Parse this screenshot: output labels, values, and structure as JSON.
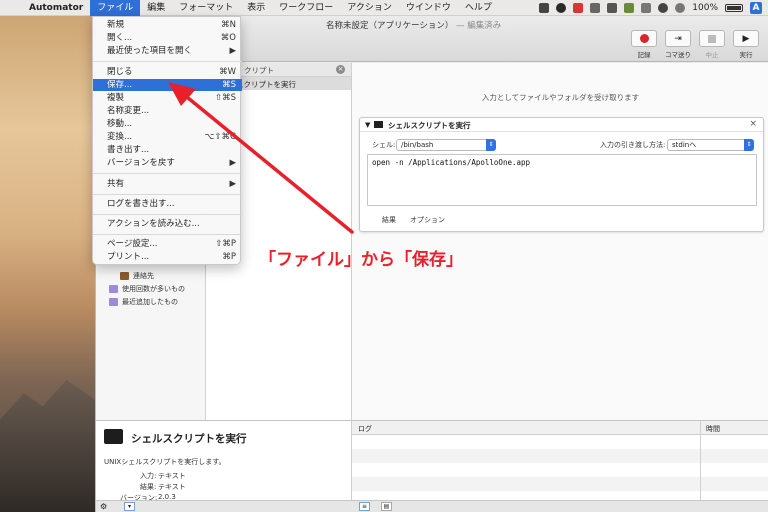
{
  "menubar": {
    "app_name": "Automator",
    "items": [
      "ファイル",
      "編集",
      "フォーマット",
      "表示",
      "ワークフロー",
      "アクション",
      "ウインドウ",
      "ヘルプ"
    ],
    "battery": "100%"
  },
  "window": {
    "title": "名称未設定（アプリケーション）",
    "title_sub": "— 編集済み",
    "toolbar": [
      {
        "label": "記録",
        "icon": "record-icon"
      },
      {
        "label": "コマ送り",
        "icon": "step-icon"
      },
      {
        "label": "中止",
        "icon": "stop-icon"
      },
      {
        "label": "実行",
        "icon": "run-icon"
      }
    ]
  },
  "file_menu": {
    "items": [
      {
        "label": "新規",
        "shortcut": "⌘N"
      },
      {
        "label": "開く...",
        "shortcut": "⌘O"
      },
      {
        "label": "最近使った項目を開く",
        "shortcut": "▶"
      },
      {
        "label": "閉じる",
        "shortcut": "⌘W"
      },
      {
        "label": "保存...",
        "shortcut": "⌘S"
      },
      {
        "label": "複製",
        "shortcut": "⇧⌘S"
      },
      {
        "label": "名称変更...",
        "shortcut": ""
      },
      {
        "label": "移動...",
        "shortcut": ""
      },
      {
        "label": "変換...",
        "shortcut": "⌥⇧⌘C"
      },
      {
        "label": "書き出す...",
        "shortcut": ""
      },
      {
        "label": "バージョンを戻す",
        "shortcut": "▶"
      },
      {
        "label": "共有",
        "shortcut": "▶"
      },
      {
        "label": "ログを書き出す...",
        "shortcut": ""
      },
      {
        "label": "アクションを読み込む...",
        "shortcut": ""
      },
      {
        "label": "ページ設定...",
        "shortcut": "⇧⌘P"
      },
      {
        "label": "プリント...",
        "shortcut": "⌘P"
      }
    ]
  },
  "library": {
    "header_title": "クリプト",
    "selected_item": "スクリプトを実行",
    "items": [
      "連絡先",
      "使用回数が多いもの",
      "最近追加したもの"
    ]
  },
  "workflow": {
    "drop_message": "入力としてファイルやフォルダを受け取ります",
    "action": {
      "title": "シェルスクリプトを実行",
      "shell_label": "シェル:",
      "shell_value": "/bin/bash",
      "pass_input_label": "入力の引き渡し方法:",
      "pass_input_value": "stdinへ",
      "script": "open -n /Applications/ApolloOne.app",
      "tabs": [
        "結果",
        "オプション"
      ]
    }
  },
  "log": {
    "col_log": "ログ",
    "col_time": "時間"
  },
  "description": {
    "title": "シェルスクリプトを実行",
    "text": "UNIXシェルスクリプトを実行します。",
    "input_label": "入力:",
    "input_value": "テキスト",
    "result_label": "結果:",
    "result_value": "テキスト",
    "version_label": "バージョン:",
    "version_value": "2.0.3"
  },
  "annotation": {
    "text": "「ファイル」から「保存」",
    "color": "#e8202a"
  }
}
